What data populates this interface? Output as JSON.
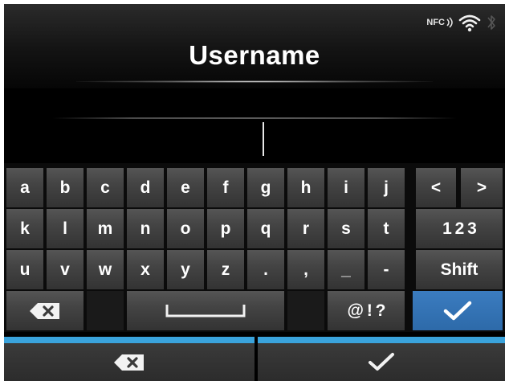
{
  "header": {
    "title": "Username",
    "status": {
      "nfc_label": "NFC",
      "icons": [
        "nfc-icon",
        "wifi-icon",
        "bluetooth-icon"
      ]
    }
  },
  "input": {
    "value": ""
  },
  "keyboard": {
    "row1": [
      "a",
      "b",
      "c",
      "d",
      "e",
      "f",
      "g",
      "h",
      "i",
      "j",
      "<",
      ">"
    ],
    "row2": [
      "k",
      "l",
      "m",
      "n",
      "o",
      "p",
      "q",
      "r",
      "s",
      "t",
      "1 2 3"
    ],
    "row3": [
      "u",
      "v",
      "w",
      "x",
      "y",
      "z",
      ".",
      ",",
      "_",
      "-",
      "Shift"
    ],
    "row4": {
      "backspace_icon": "backspace-icon",
      "space_icon": "space-icon",
      "symbols": "@ ! ?",
      "confirm_icon": "checkmark-icon"
    }
  },
  "bottom_bar": {
    "backspace_icon": "backspace-icon",
    "confirm_icon": "checkmark-icon"
  },
  "colors": {
    "accent": "#3aa3dc",
    "confirm_key": "#2f6fae",
    "key": "#444444",
    "background": "#000000"
  }
}
